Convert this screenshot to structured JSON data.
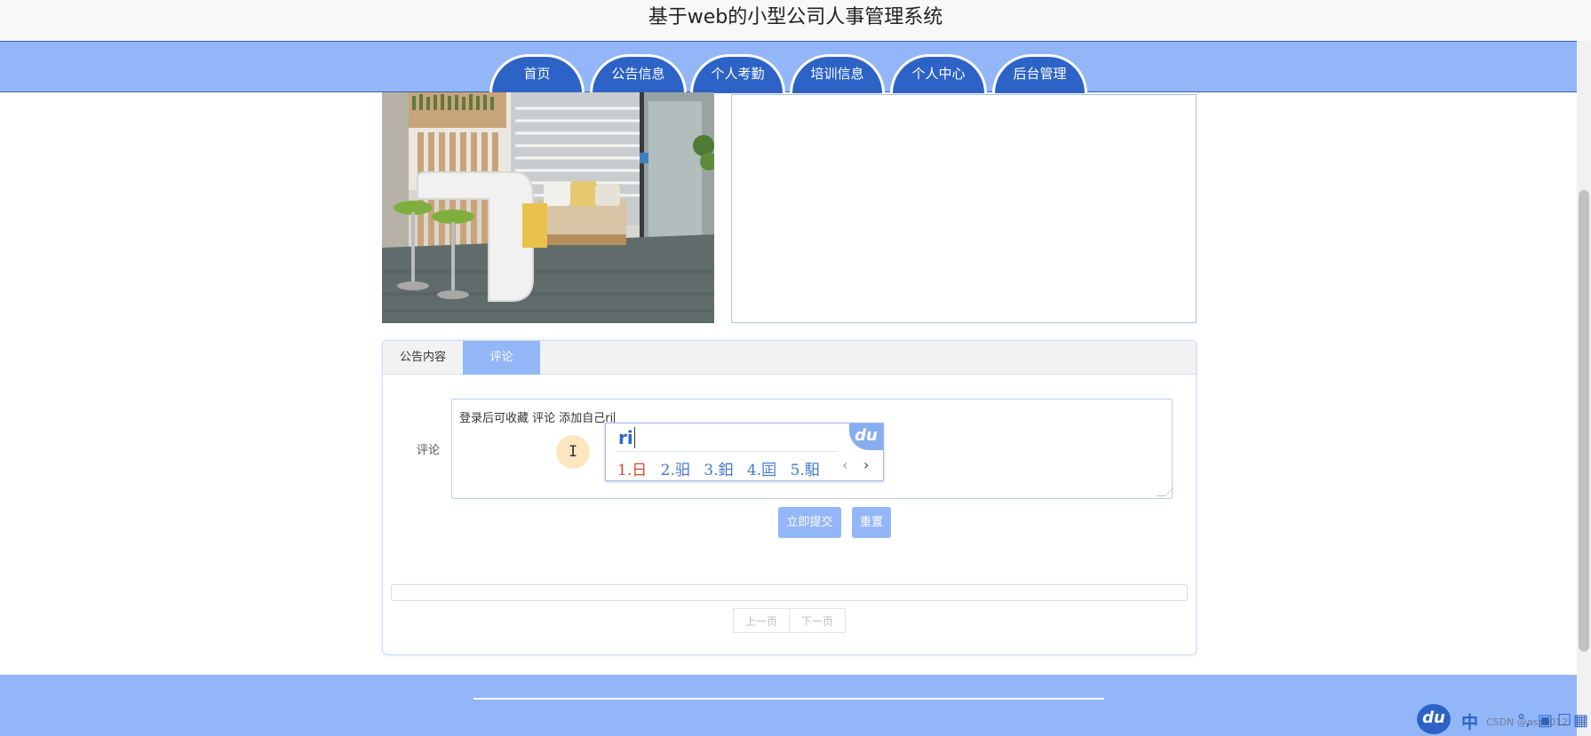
{
  "site": {
    "title": "基于web的小型公司人事管理系统"
  },
  "nav": {
    "items": [
      {
        "label": "首页"
      },
      {
        "label": "公告信息"
      },
      {
        "label": "个人考勤"
      },
      {
        "label": "培训信息"
      },
      {
        "label": "个人中心"
      },
      {
        "label": "后台管理"
      }
    ]
  },
  "detail": {
    "tabs": [
      {
        "label": "公告内容",
        "active": false
      },
      {
        "label": "评论",
        "active": true
      }
    ],
    "comment": {
      "label": "评论",
      "value": "登录后可收藏 评论 添加自己ri"
    },
    "buttons": {
      "submit": "立即提交",
      "reset": "重置"
    },
    "pager": {
      "prev": "上一页",
      "next": "下一页"
    }
  },
  "ime": {
    "logo": "du",
    "input": "ri",
    "candidates": [
      "1.日",
      "2.驲",
      "3.鈤",
      "4.囸",
      "5.馹"
    ]
  },
  "taskbar": {
    "ime_logo": "du",
    "ime_lang": "中",
    "watermark": "CSDN @ass1012"
  },
  "colors": {
    "nav_bg": "#93b6f8",
    "tab_bg": "#2d63c7",
    "accent": "#93b6f8",
    "footer_bg": "#93b6f8"
  }
}
